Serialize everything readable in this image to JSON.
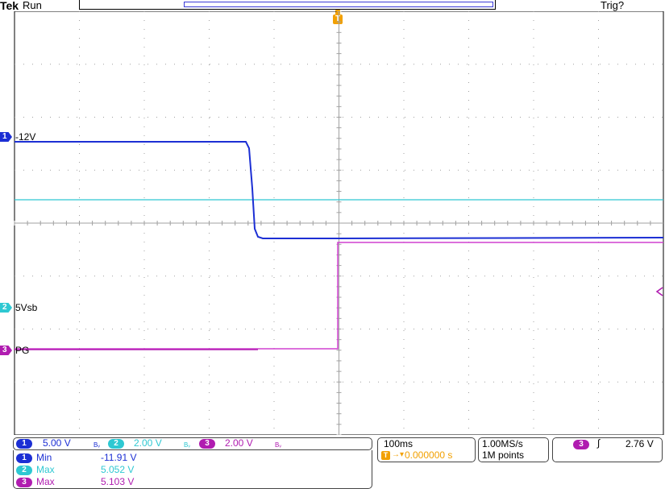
{
  "header": {
    "brand": "Tek",
    "status": "Run",
    "trigger_status": "Trig?",
    "trigger_marker": "T"
  },
  "channels": [
    {
      "id": "1",
      "color": "#1c2fd4",
      "label": "-12V",
      "scale": "5.00 V"
    },
    {
      "id": "2",
      "color": "#2ec8d2",
      "label": "5Vsb",
      "scale": "2.00 V"
    },
    {
      "id": "3",
      "color": "#b01cb0",
      "label": "PG",
      "scale": "2.00 V"
    }
  ],
  "bandwidth_mark": "Bᵥ",
  "timebase": {
    "scale": "100ms",
    "position": "0.000000 s"
  },
  "acquisition": {
    "rate": "1.00MS/s",
    "points": "1M points"
  },
  "trigger": {
    "source": "3",
    "slope_icon": "∫",
    "level": "2.76 V"
  },
  "measurements": [
    {
      "channel": "1",
      "name": "Min",
      "value": "-11.91 V"
    },
    {
      "channel": "2",
      "name": "Max",
      "value": "5.052 V"
    },
    {
      "channel": "3",
      "name": "Max",
      "value": "5.103 V"
    }
  ],
  "colors": {
    "trigger": "#f2a000",
    "grid": "#a0a0a0"
  }
}
